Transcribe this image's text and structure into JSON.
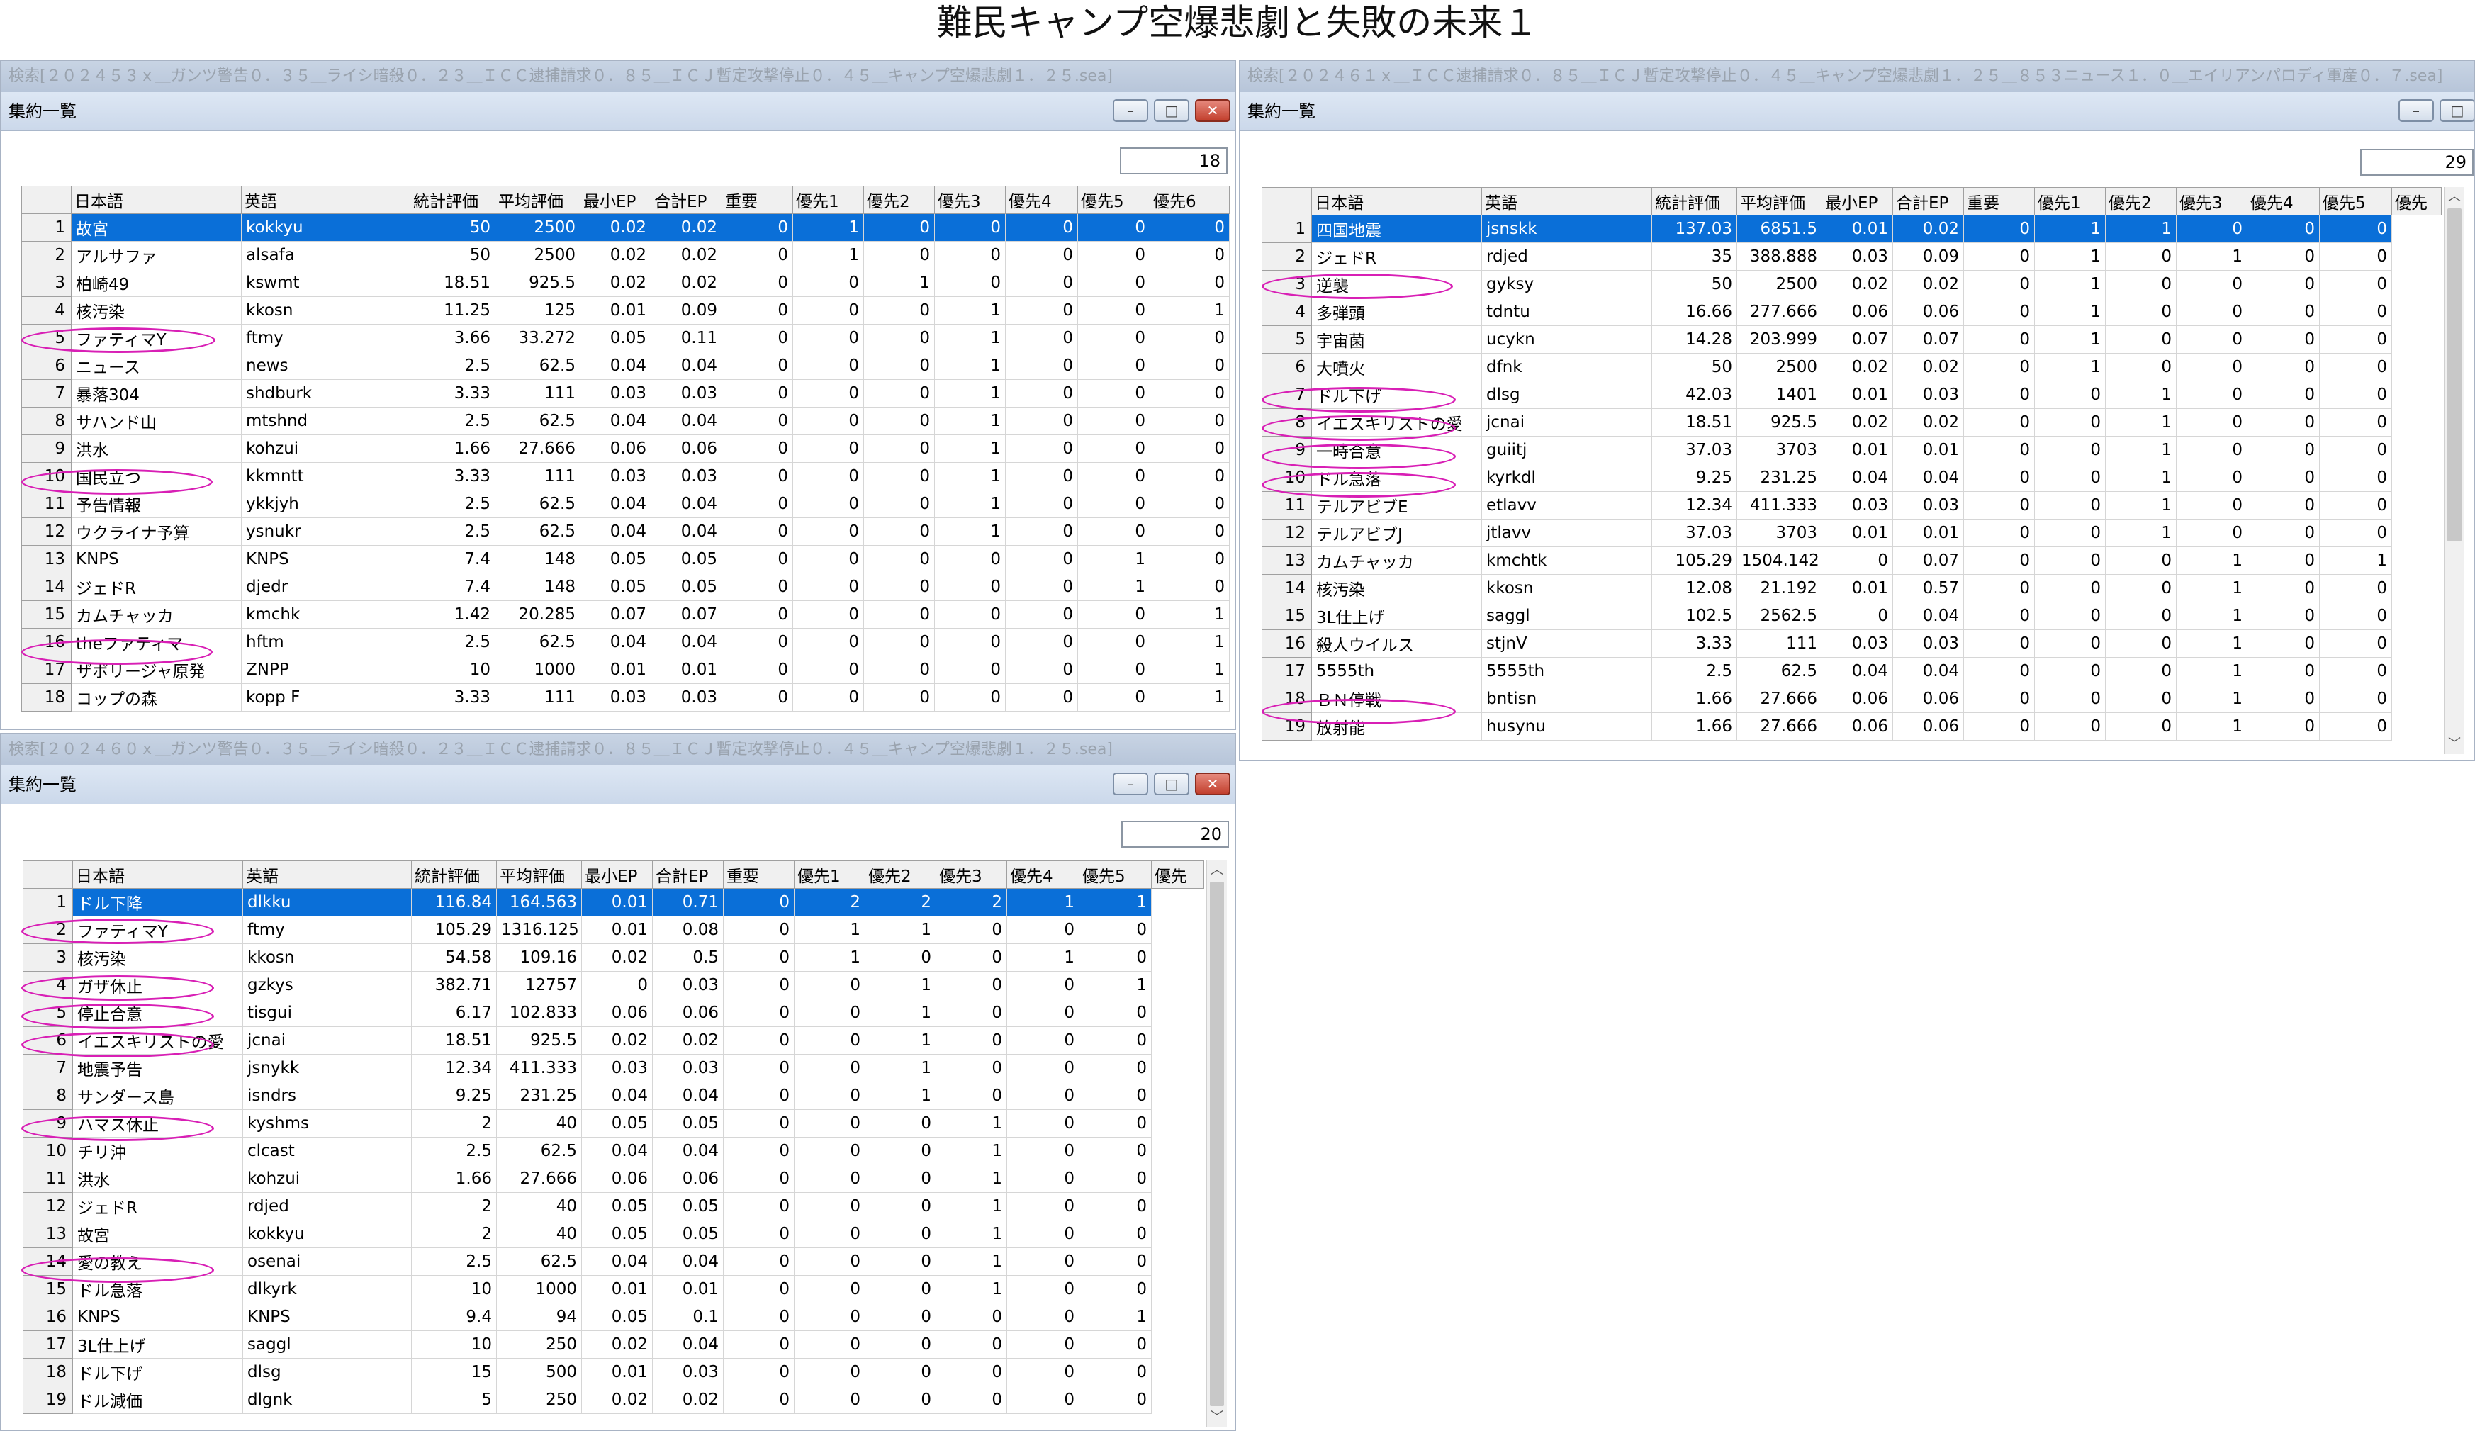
{
  "page_title": "難民キャンプ空爆悲劇と失敗の未来１",
  "columns_full": [
    "日本語",
    "英語",
    "統計評価",
    "平均評価",
    "最小EP",
    "合計EP",
    "重要",
    "優先1",
    "優先2",
    "優先3",
    "優先4",
    "優先5",
    "優先6"
  ],
  "columns_w2": [
    "日本語",
    "英語",
    "統計評価",
    "平均評価",
    "最小EP",
    "合計EP",
    "重要",
    "優先1",
    "優先2",
    "優先3",
    "優先4",
    "優先5",
    "優先"
  ],
  "win1": {
    "search": "検索[２０２４５３ｘ＿ガンツ警告０．３５＿ライシ暗殺０．２３＿ＩＣＣ逮捕請求０．８５＿ＩＣＪ暫定攻撃停止０．４５＿キャンプ空爆悲劇１．２５.sea]",
    "title": "集約一覧",
    "count": "18",
    "rows": [
      [
        "1",
        "故宮",
        "kokkyu",
        "50",
        "2500",
        "0.02",
        "0.02",
        "0",
        "1",
        "0",
        "0",
        "0",
        "0",
        "0"
      ],
      [
        "2",
        "アルサファ",
        "alsafa",
        "50",
        "2500",
        "0.02",
        "0.02",
        "0",
        "1",
        "0",
        "0",
        "0",
        "0",
        "0"
      ],
      [
        "3",
        "柏崎49",
        "kswmt",
        "18.51",
        "925.5",
        "0.02",
        "0.02",
        "0",
        "0",
        "1",
        "0",
        "0",
        "0",
        "0"
      ],
      [
        "4",
        "核汚染",
        "kkosn",
        "11.25",
        "125",
        "0.01",
        "0.09",
        "0",
        "0",
        "0",
        "1",
        "0",
        "0",
        "1"
      ],
      [
        "5",
        "ファティマY",
        "ftmy",
        "3.66",
        "33.272",
        "0.05",
        "0.11",
        "0",
        "0",
        "0",
        "1",
        "0",
        "0",
        "0"
      ],
      [
        "6",
        "ニュース",
        "news",
        "2.5",
        "62.5",
        "0.04",
        "0.04",
        "0",
        "0",
        "0",
        "1",
        "0",
        "0",
        "0"
      ],
      [
        "7",
        "暴落304",
        "shdburk",
        "3.33",
        "111",
        "0.03",
        "0.03",
        "0",
        "0",
        "0",
        "1",
        "0",
        "0",
        "0"
      ],
      [
        "8",
        "サハンド山",
        "mtshnd",
        "2.5",
        "62.5",
        "0.04",
        "0.04",
        "0",
        "0",
        "0",
        "1",
        "0",
        "0",
        "0"
      ],
      [
        "9",
        "洪水",
        "kohzui",
        "1.66",
        "27.666",
        "0.06",
        "0.06",
        "0",
        "0",
        "0",
        "1",
        "0",
        "0",
        "0"
      ],
      [
        "10",
        "国民立つ",
        "kkmntt",
        "3.33",
        "111",
        "0.03",
        "0.03",
        "0",
        "0",
        "0",
        "1",
        "0",
        "0",
        "0"
      ],
      [
        "11",
        "予告情報",
        "ykkjyh",
        "2.5",
        "62.5",
        "0.04",
        "0.04",
        "0",
        "0",
        "0",
        "1",
        "0",
        "0",
        "0"
      ],
      [
        "12",
        "ウクライナ予算",
        "ysnukr",
        "2.5",
        "62.5",
        "0.04",
        "0.04",
        "0",
        "0",
        "0",
        "1",
        "0",
        "0",
        "0"
      ],
      [
        "13",
        "KNPS",
        "KNPS",
        "7.4",
        "148",
        "0.05",
        "0.05",
        "0",
        "0",
        "0",
        "0",
        "0",
        "1",
        "0"
      ],
      [
        "14",
        "ジェドR",
        "djedr",
        "7.4",
        "148",
        "0.05",
        "0.05",
        "0",
        "0",
        "0",
        "0",
        "0",
        "1",
        "0"
      ],
      [
        "15",
        "カムチャッカ",
        "kmchk",
        "1.42",
        "20.285",
        "0.07",
        "0.07",
        "0",
        "0",
        "0",
        "0",
        "0",
        "0",
        "1"
      ],
      [
        "16",
        "theファティマ",
        "hftm",
        "2.5",
        "62.5",
        "0.04",
        "0.04",
        "0",
        "0",
        "0",
        "0",
        "0",
        "0",
        "1"
      ],
      [
        "17",
        "ザポリージャ原発",
        "ZNPP",
        "10",
        "1000",
        "0.01",
        "0.01",
        "0",
        "0",
        "0",
        "0",
        "0",
        "0",
        "1"
      ],
      [
        "18",
        "コップの森",
        "kopp F",
        "3.33",
        "111",
        "0.03",
        "0.03",
        "0",
        "0",
        "0",
        "0",
        "0",
        "0",
        "1"
      ]
    ]
  },
  "win2": {
    "search": "検索[２０２４６１ｘ＿ＩＣＣ逮捕請求０．８５＿ＩＣＪ暫定攻撃停止０．４５＿キャンプ空爆悲劇１．２５＿８５３ニュース１．０＿エイリアンパロディ軍産０．７.sea]",
    "title": "集約一覧",
    "count": "29",
    "rows": [
      [
        "1",
        "四国地震",
        "jsnskk",
        "137.03",
        "6851.5",
        "0.01",
        "0.02",
        "0",
        "1",
        "1",
        "0",
        "0",
        "0"
      ],
      [
        "2",
        "ジェドR",
        "rdjed",
        "35",
        "388.888",
        "0.03",
        "0.09",
        "0",
        "1",
        "0",
        "1",
        "0",
        "0"
      ],
      [
        "3",
        "逆襲",
        "gyksy",
        "50",
        "2500",
        "0.02",
        "0.02",
        "0",
        "1",
        "0",
        "0",
        "0",
        "0"
      ],
      [
        "4",
        "多弾頭",
        "tdntu",
        "16.66",
        "277.666",
        "0.06",
        "0.06",
        "0",
        "1",
        "0",
        "0",
        "0",
        "0"
      ],
      [
        "5",
        "宇宙菌",
        "ucykn",
        "14.28",
        "203.999",
        "0.07",
        "0.07",
        "0",
        "1",
        "0",
        "0",
        "0",
        "0"
      ],
      [
        "6",
        "大噴火",
        "dfnk",
        "50",
        "2500",
        "0.02",
        "0.02",
        "0",
        "1",
        "0",
        "0",
        "0",
        "0"
      ],
      [
        "7",
        "ドル下げ",
        "dlsg",
        "42.03",
        "1401",
        "0.01",
        "0.03",
        "0",
        "0",
        "1",
        "0",
        "0",
        "0"
      ],
      [
        "8",
        "イエスキリストの愛",
        "jcnai",
        "18.51",
        "925.5",
        "0.02",
        "0.02",
        "0",
        "0",
        "1",
        "0",
        "0",
        "0"
      ],
      [
        "9",
        "一時合意",
        "guiitj",
        "37.03",
        "3703",
        "0.01",
        "0.01",
        "0",
        "0",
        "1",
        "0",
        "0",
        "0"
      ],
      [
        "10",
        "ドル急落",
        "kyrkdl",
        "9.25",
        "231.25",
        "0.04",
        "0.04",
        "0",
        "0",
        "1",
        "0",
        "0",
        "0"
      ],
      [
        "11",
        "テルアビブE",
        "etlavv",
        "12.34",
        "411.333",
        "0.03",
        "0.03",
        "0",
        "0",
        "1",
        "0",
        "0",
        "0"
      ],
      [
        "12",
        "テルアビブJ",
        "jtlavv",
        "37.03",
        "3703",
        "0.01",
        "0.01",
        "0",
        "0",
        "1",
        "0",
        "0",
        "0"
      ],
      [
        "13",
        "カムチャッカ",
        "kmchtk",
        "105.29",
        "1504.142",
        "0",
        "0.07",
        "0",
        "0",
        "0",
        "1",
        "0",
        "1"
      ],
      [
        "14",
        "核汚染",
        "kkosn",
        "12.08",
        "21.192",
        "0.01",
        "0.57",
        "0",
        "0",
        "0",
        "1",
        "0",
        "0"
      ],
      [
        "15",
        "3L仕上げ",
        "saggl",
        "102.5",
        "2562.5",
        "0",
        "0.04",
        "0",
        "0",
        "0",
        "1",
        "0",
        "0"
      ],
      [
        "16",
        "殺人ウイルス",
        "stjnV",
        "3.33",
        "111",
        "0.03",
        "0.03",
        "0",
        "0",
        "0",
        "1",
        "0",
        "0"
      ],
      [
        "17",
        "5555th",
        "5555th",
        "2.5",
        "62.5",
        "0.04",
        "0.04",
        "0",
        "0",
        "0",
        "1",
        "0",
        "0"
      ],
      [
        "18",
        "ＢＮ停戦",
        "bntisn",
        "1.66",
        "27.666",
        "0.06",
        "0.06",
        "0",
        "0",
        "0",
        "1",
        "0",
        "0"
      ],
      [
        "19",
        "放射能",
        "husynu",
        "1.66",
        "27.666",
        "0.06",
        "0.06",
        "0",
        "0",
        "0",
        "1",
        "0",
        "0"
      ]
    ]
  },
  "win3": {
    "search": "検索[２０２４６０ｘ＿ガンツ警告０．３５＿ライシ暗殺０．２３＿ＩＣＣ逮捕請求０．８５＿ＩＣＪ暫定攻撃停止０．４５＿キャンプ空爆悲劇１．２５.sea]",
    "title": "集約一覧",
    "count": "20",
    "rows": [
      [
        "1",
        "ドル下降",
        "dlkku",
        "116.84",
        "164.563",
        "0.01",
        "0.71",
        "0",
        "2",
        "2",
        "2",
        "1",
        "1"
      ],
      [
        "2",
        "ファティマY",
        "ftmy",
        "105.29",
        "1316.125",
        "0.01",
        "0.08",
        "0",
        "1",
        "1",
        "0",
        "0",
        "0"
      ],
      [
        "3",
        "核汚染",
        "kkosn",
        "54.58",
        "109.16",
        "0.02",
        "0.5",
        "0",
        "1",
        "0",
        "0",
        "1",
        "0"
      ],
      [
        "4",
        "ガザ休止",
        "gzkys",
        "382.71",
        "12757",
        "0",
        "0.03",
        "0",
        "0",
        "1",
        "0",
        "0",
        "1"
      ],
      [
        "5",
        "停止合意",
        "tisgui",
        "6.17",
        "102.833",
        "0.06",
        "0.06",
        "0",
        "0",
        "1",
        "0",
        "0",
        "0"
      ],
      [
        "6",
        "イエスキリストの愛",
        "jcnai",
        "18.51",
        "925.5",
        "0.02",
        "0.02",
        "0",
        "0",
        "1",
        "0",
        "0",
        "0"
      ],
      [
        "7",
        "地震予告",
        "jsnykk",
        "12.34",
        "411.333",
        "0.03",
        "0.03",
        "0",
        "0",
        "1",
        "0",
        "0",
        "0"
      ],
      [
        "8",
        "サンダース島",
        "isndrs",
        "9.25",
        "231.25",
        "0.04",
        "0.04",
        "0",
        "0",
        "1",
        "0",
        "0",
        "0"
      ],
      [
        "9",
        "ハマス休止",
        "kyshms",
        "2",
        "40",
        "0.05",
        "0.05",
        "0",
        "0",
        "0",
        "1",
        "0",
        "0"
      ],
      [
        "10",
        "チリ沖",
        "clcast",
        "2.5",
        "62.5",
        "0.04",
        "0.04",
        "0",
        "0",
        "0",
        "1",
        "0",
        "0"
      ],
      [
        "11",
        "洪水",
        "kohzui",
        "1.66",
        "27.666",
        "0.06",
        "0.06",
        "0",
        "0",
        "0",
        "1",
        "0",
        "0"
      ],
      [
        "12",
        "ジェドR",
        "rdjed",
        "2",
        "40",
        "0.05",
        "0.05",
        "0",
        "0",
        "0",
        "1",
        "0",
        "0"
      ],
      [
        "13",
        "故宮",
        "kokkyu",
        "2",
        "40",
        "0.05",
        "0.05",
        "0",
        "0",
        "0",
        "1",
        "0",
        "0"
      ],
      [
        "14",
        "愛の教え",
        "osenai",
        "2.5",
        "62.5",
        "0.04",
        "0.04",
        "0",
        "0",
        "0",
        "1",
        "0",
        "0"
      ],
      [
        "15",
        "ドル急落",
        "dlkyrk",
        "10",
        "1000",
        "0.01",
        "0.01",
        "0",
        "0",
        "0",
        "1",
        "0",
        "0"
      ],
      [
        "16",
        "KNPS",
        "KNPS",
        "9.4",
        "94",
        "0.05",
        "0.1",
        "0",
        "0",
        "0",
        "0",
        "0",
        "1"
      ],
      [
        "17",
        "3L仕上げ",
        "saggl",
        "10",
        "250",
        "0.02",
        "0.04",
        "0",
        "0",
        "0",
        "0",
        "0",
        "0"
      ],
      [
        "18",
        "ドル下げ",
        "dlsg",
        "15",
        "500",
        "0.01",
        "0.03",
        "0",
        "0",
        "0",
        "0",
        "0",
        "0"
      ],
      [
        "19",
        "ドル減価",
        "dlgnk",
        "5",
        "250",
        "0.02",
        "0.02",
        "0",
        "0",
        "0",
        "0",
        "0",
        "0"
      ]
    ]
  },
  "icons": {
    "minimize": "minimize-icon",
    "maximize": "maximize-icon",
    "close": "close-icon"
  },
  "colors": {
    "selection": "#0a6fd8",
    "annotation": "#d81fb5",
    "titlebar": "#cbd8ea"
  }
}
